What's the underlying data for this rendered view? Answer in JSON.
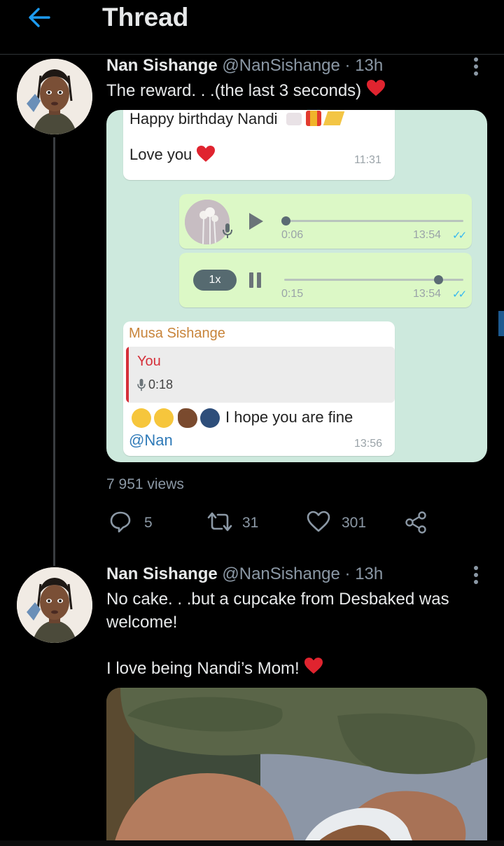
{
  "header": {
    "title": "Thread",
    "back_icon": "arrow-left-icon",
    "accent": "#1d9bf0"
  },
  "tweets": [
    {
      "name": "Nan Sishange",
      "handle": "@NanSishange",
      "separator": "·",
      "time": "13h",
      "text": "The reward. . .(the last 3 seconds)",
      "emoji": "red-heart",
      "views": "7 951 views",
      "actions": {
        "reply": "5",
        "retweet": "31",
        "like": "301"
      }
    },
    {
      "name": "Nan Sishange",
      "handle": "@NanSishange",
      "separator": "·",
      "time": "13h",
      "text_line1": "No cake. . .but a cupcake from Desbaked was",
      "text_line2": "welcome!",
      "text_line3": "I love being Nandi’s Mom!",
      "emoji": "red-heart"
    }
  ],
  "chat": {
    "msg1_line1": "Happy birthday Nandi",
    "msg1_line2": "Love you",
    "msg1_time": "11:31",
    "voice1_duration": "0:06",
    "voice1_time": "13:54",
    "voice1_progress": 0,
    "voice2_speed": "1x",
    "voice2_duration": "0:15",
    "voice2_time": "13:54",
    "voice2_progress": 0.85,
    "reply_sender": "Musa Sishange",
    "reply_quote_author": "You",
    "reply_quote_duration": "0:18",
    "reply_text": "I hope you are fine",
    "reply_mention": "@Nan",
    "reply_time": "13:56",
    "colors": {
      "chat_bg": "#cde9dd",
      "outgoing": "#dcf8c6",
      "incoming": "#ffffff",
      "sender": "#c8843a",
      "quote_author": "#d5303a",
      "mention": "#2f7ab8",
      "read_ticks": "#34b7f1"
    }
  }
}
